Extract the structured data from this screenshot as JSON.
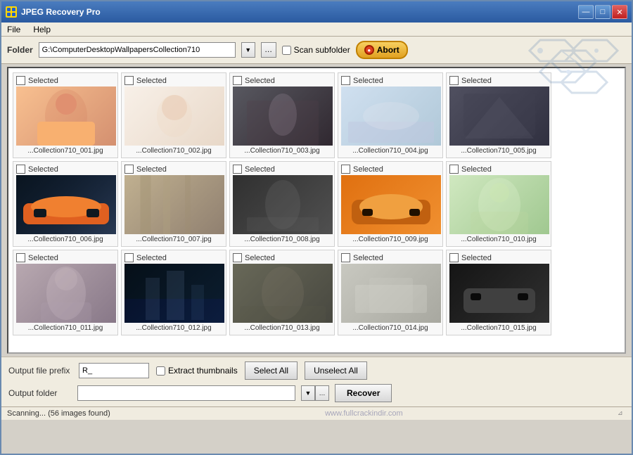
{
  "titleBar": {
    "title": "JPEG Recovery Pro",
    "controls": {
      "minimize": "—",
      "maximize": "□",
      "close": "✕"
    }
  },
  "menuBar": {
    "items": [
      {
        "label": "File"
      },
      {
        "label": "Help"
      }
    ]
  },
  "toolbar": {
    "folderLabel": "Folder",
    "folderPath": "G:\\ComputerDesktopWallpapersCollection710",
    "scanSubfolder": "Scan subfolder",
    "abortBtn": "Abort"
  },
  "images": [
    {
      "id": "001",
      "name": "...Collection710_001.jpg",
      "colorClass": "img-001"
    },
    {
      "id": "002",
      "name": "...Collection710_002.jpg",
      "colorClass": "img-002"
    },
    {
      "id": "003",
      "name": "...Collection710_003.jpg",
      "colorClass": "img-003"
    },
    {
      "id": "004",
      "name": "...Collection710_004.jpg",
      "colorClass": "img-004"
    },
    {
      "id": "005",
      "name": "...Collection710_005.jpg",
      "colorClass": "img-005"
    },
    {
      "id": "006",
      "name": "...Collection710_006.jpg",
      "colorClass": "img-006"
    },
    {
      "id": "007",
      "name": "...Collection710_007.jpg",
      "colorClass": "img-007"
    },
    {
      "id": "008",
      "name": "...Collection710_008.jpg",
      "colorClass": "img-008"
    },
    {
      "id": "009",
      "name": "...Collection710_009.jpg",
      "colorClass": "img-009"
    },
    {
      "id": "010",
      "name": "...Collection710_010.jpg",
      "colorClass": "img-010"
    },
    {
      "id": "011",
      "name": "...Collection710_011.jpg",
      "colorClass": "img-011"
    },
    {
      "id": "012",
      "name": "...Collection710_012.jpg",
      "colorClass": "img-012"
    },
    {
      "id": "013",
      "name": "...Collection710_013.jpg",
      "colorClass": "img-013"
    },
    {
      "id": "014",
      "name": "...Collection710_014.jpg",
      "colorClass": "img-014"
    },
    {
      "id": "015",
      "name": "...Collection710_015.jpg",
      "colorClass": "img-015"
    }
  ],
  "selectedLabel": "Selected",
  "bottomToolbar": {
    "outputPrefixLabel": "Output file prefix",
    "outputPrefix": "R_",
    "extractThumbnails": "Extract thumbnails",
    "selectAll": "Select All",
    "unselectAll": "Unselect All",
    "outputFolderLabel": "Output folder",
    "outputFolder": "",
    "recover": "Recover"
  },
  "statusBar": {
    "status": "Scanning... (56 images found)",
    "watermark": "www.fullcrackindir.com"
  }
}
